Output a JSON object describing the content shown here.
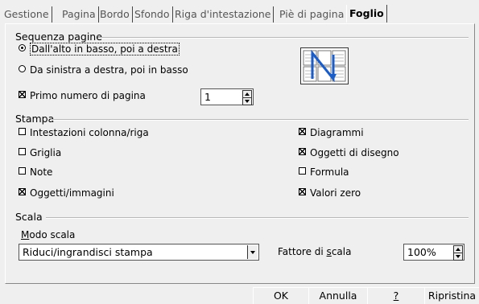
{
  "tabs": [
    {
      "label": "Gestione"
    },
    {
      "label": "Pagina"
    },
    {
      "label": "Bordo"
    },
    {
      "label": "Sfondo"
    },
    {
      "label": "Riga d'intestazione"
    },
    {
      "label": "Piè di pagina"
    },
    {
      "label": "Foglio"
    }
  ],
  "active_tab": "Foglio",
  "page_order": {
    "title": "Sequenza pagine",
    "options": [
      {
        "label": "Dall'alto in basso, poi a destra",
        "selected": true
      },
      {
        "label": "Da sinistra a destra, poi in basso",
        "selected": false
      }
    ],
    "first_page_number": {
      "label": "Primo numero di pagina",
      "checked": true,
      "value": "1"
    },
    "preview_icon": "page-order-preview-icon"
  },
  "print": {
    "title": "Stampa",
    "left": [
      {
        "label": "Intestazioni colonna/riga",
        "checked": false
      },
      {
        "label": "Griglia",
        "checked": false
      },
      {
        "label": "Note",
        "checked": false
      },
      {
        "label": "Oggetti/immagini",
        "checked": true
      }
    ],
    "right": [
      {
        "label": "Diagrammi",
        "checked": true
      },
      {
        "label": "Oggetti di disegno",
        "checked": true
      },
      {
        "label": "Formula",
        "checked": false
      },
      {
        "label": "Valori zero",
        "checked": true
      }
    ]
  },
  "scale": {
    "title": "Scala",
    "mode_label_prefix": "M",
    "mode_label_rest": "odo scala",
    "mode_value": "Riduci/ingrandisci stampa",
    "factor_label_pre": "Fattore di ",
    "factor_label_ul": "s",
    "factor_label_post": "cala",
    "factor_value": "100%"
  },
  "buttons": {
    "ok": "OK",
    "cancel": "Annulla",
    "help": "?",
    "reset": "Ripristina"
  }
}
